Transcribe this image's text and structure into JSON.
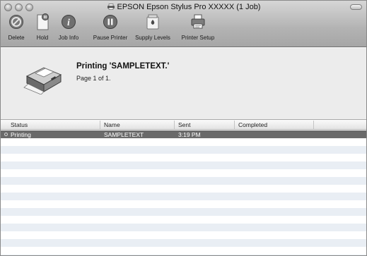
{
  "window": {
    "title": "EPSON Epson Stylus Pro XXXXX (1 Job)"
  },
  "toolbar": {
    "buttons": [
      {
        "label": "Delete",
        "icon": "delete-icon"
      },
      {
        "label": "Hold",
        "icon": "hold-icon"
      },
      {
        "label": "Job Info",
        "icon": "info-icon"
      },
      {
        "label": "Pause Printer",
        "icon": "pause-icon"
      },
      {
        "label": "Supply Levels",
        "icon": "supply-levels-icon"
      },
      {
        "label": "Printer Setup",
        "icon": "printer-setup-icon"
      }
    ]
  },
  "status": {
    "message": "Printing 'SAMPLETEXT.'",
    "page_info": "Page 1 of 1."
  },
  "table": {
    "columns": [
      "Status",
      "Name",
      "Sent",
      "Completed"
    ],
    "rows": [
      {
        "status": "Printing",
        "name": "SAMPLETEXT",
        "sent": "3:19 PM",
        "completed": ""
      }
    ]
  }
}
